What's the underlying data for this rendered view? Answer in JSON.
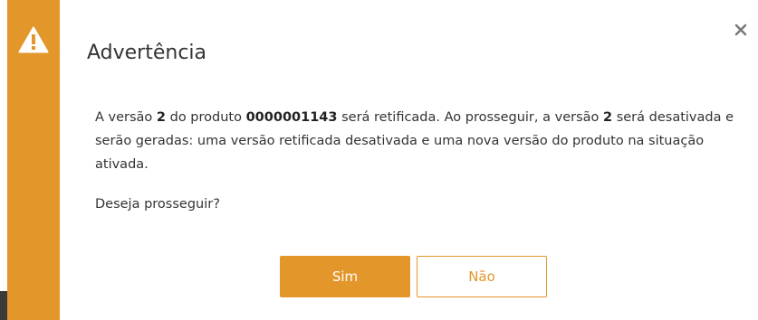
{
  "dialog": {
    "title": "Advertência",
    "icon": "warning-icon",
    "close_icon": "close-icon",
    "accent_color": "#e3962a",
    "message": {
      "p1": "A versão ",
      "version": "2",
      "p2": " do produto ",
      "product": "0000001143",
      "p3": " será retificada. Ao prosseguir, a versão ",
      "version2": "2",
      "p4": " será desativada e serão geradas: uma versão retificada desativada e uma nova versão do produto na situação ativada."
    },
    "question": "Deseja prosseguir?",
    "buttons": {
      "yes": "Sim",
      "no": "Não"
    }
  }
}
